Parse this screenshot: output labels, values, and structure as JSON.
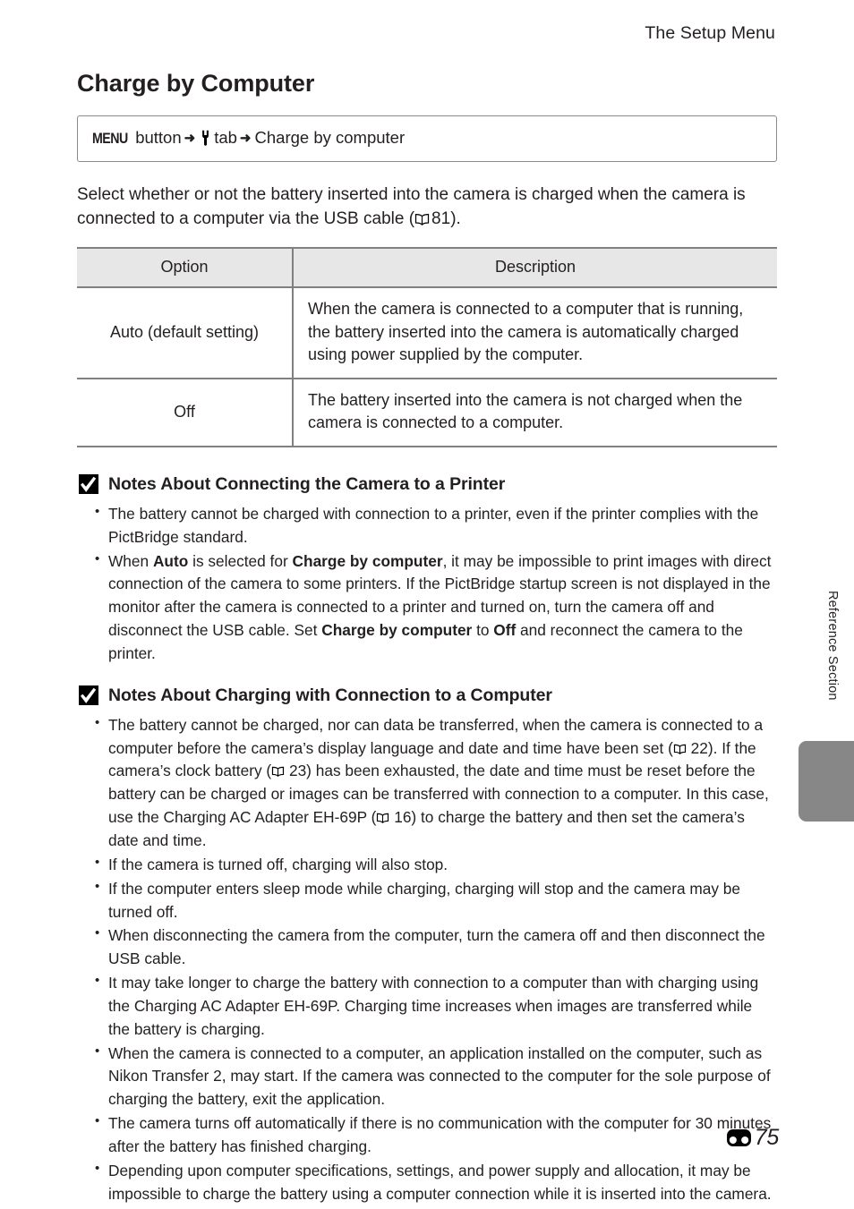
{
  "header": {
    "running_title": "The Setup Menu"
  },
  "chapter": {
    "title": "Charge by Computer"
  },
  "path_box": {
    "menu_label": "MENU",
    "button_word": "button",
    "arrow": "➜",
    "tab_word": "tab",
    "destination": "Charge by computer",
    "wrench_icon_name": "setup-wrench-icon"
  },
  "intro": {
    "text_before_ref": "Select whether or not the battery inserted into the camera is charged when the camera is connected to a computer via the USB cable (",
    "ref_page": "81",
    "text_after_ref": ")."
  },
  "option_table": {
    "columns": [
      "Option",
      "Description"
    ],
    "rows": [
      {
        "option": "Auto (default setting)",
        "description": "When the camera is connected to a computer that is running, the battery inserted into the camera is automatically charged using power supplied by the computer."
      },
      {
        "option": "Off",
        "description": "The battery inserted into the camera is not charged when the camera is connected to a computer."
      }
    ]
  },
  "notes_printer": {
    "heading": "Notes About Connecting the Camera to a Printer",
    "icon_name": "caution-check-icon",
    "bullets": [
      {
        "parts": [
          {
            "t": "The battery cannot be charged with connection to a printer, even if the printer complies with the PictBridge standard.",
            "b": false
          }
        ]
      },
      {
        "parts": [
          {
            "t": "When ",
            "b": false
          },
          {
            "t": "Auto",
            "b": true
          },
          {
            "t": " is selected for ",
            "b": false
          },
          {
            "t": "Charge by computer",
            "b": true
          },
          {
            "t": ", it may be impossible to print images with direct connection of the camera to some printers. If the PictBridge startup screen is not displayed in the monitor after the camera is connected to a printer and turned on, turn the camera off and disconnect the USB cable. Set ",
            "b": false
          },
          {
            "t": "Charge by computer",
            "b": true
          },
          {
            "t": " to ",
            "b": false
          },
          {
            "t": "Off",
            "b": true
          },
          {
            "t": " and reconnect the camera to the printer.",
            "b": false
          }
        ]
      }
    ]
  },
  "notes_computer": {
    "heading": "Notes About Charging with Connection to a Computer",
    "icon_name": "caution-check-icon",
    "bullets": [
      {
        "parts": [
          {
            "t": "The battery cannot be charged, nor can data be transferred, when the camera is connected to a computer before the camera’s display language and date and time have been set (",
            "b": false
          },
          {
            "t": "\u0001BOOK",
            "b": false
          },
          {
            "t": " 22). If the camera’s clock battery (",
            "b": false
          },
          {
            "t": "\u0001BOOK",
            "b": false
          },
          {
            "t": " 23) has been exhausted, the date and time must be reset before the battery can be charged or images can be transferred with connection to a computer. In this case, use the Charging AC Adapter EH-69P (",
            "b": false
          },
          {
            "t": "\u0001BOOK",
            "b": false
          },
          {
            "t": " 16) to charge the battery and then set the camera’s date and time.",
            "b": false
          }
        ]
      },
      {
        "parts": [
          {
            "t": "If the camera is turned off, charging will also stop.",
            "b": false
          }
        ]
      },
      {
        "parts": [
          {
            "t": "If the computer enters sleep mode while charging, charging will stop and the camera may be turned off.",
            "b": false
          }
        ]
      },
      {
        "parts": [
          {
            "t": "When disconnecting the camera from the computer, turn the camera off and then disconnect the USB cable.",
            "b": false
          }
        ]
      },
      {
        "parts": [
          {
            "t": "It may take longer to charge the battery with connection to a computer than with charging using the Charging AC Adapter EH-69P. Charging time increases when images are transferred while the battery is charging.",
            "b": false
          }
        ]
      },
      {
        "parts": [
          {
            "t": "When the camera is connected to a computer, an application installed on the computer, such as Nikon Transfer 2, may start. If the camera was connected to the computer for the sole purpose of charging the battery, exit the application.",
            "b": false
          }
        ]
      },
      {
        "parts": [
          {
            "t": "The camera turns off automatically if there is no communication with the computer for 30 minutes after the battery has finished charging.",
            "b": false
          }
        ]
      },
      {
        "parts": [
          {
            "t": "Depending upon computer specifications, settings, and power supply and allocation, it may be impossible to charge the battery using a computer connection while it is inserted into the camera.",
            "b": false
          }
        ]
      }
    ]
  },
  "side_margin": {
    "label": "Reference Section",
    "tab_color": "#878787"
  },
  "footer": {
    "section_symbol_name": "reference-section-symbol",
    "page_number": "75"
  }
}
